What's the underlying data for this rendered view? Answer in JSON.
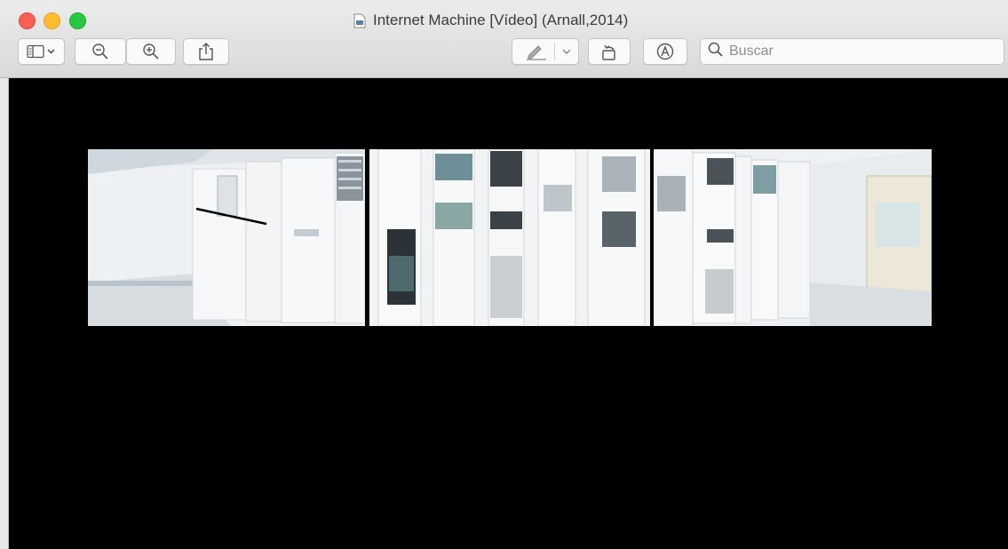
{
  "window": {
    "title": "Internet Machine [Vídeo] (Arnall,2014)"
  },
  "toolbar": {
    "buttons": [
      {
        "name": "sidebar-toggle-button",
        "icon": "sidebar-icon"
      },
      {
        "name": "zoom-out-button",
        "icon": "zoom-out-icon"
      },
      {
        "name": "zoom-in-button",
        "icon": "zoom-in-icon"
      },
      {
        "name": "share-button",
        "icon": "share-icon"
      },
      {
        "name": "markup-button",
        "icon": "pen-icon"
      },
      {
        "name": "rotate-button",
        "icon": "rotate-icon"
      },
      {
        "name": "annotate-button",
        "icon": "markup-circle-icon"
      }
    ],
    "search": {
      "placeholder": "Buscar"
    }
  },
  "viewer": {
    "background": "#000000",
    "image_panels": [
      "server-room-left",
      "server-racks-center",
      "server-room-right"
    ]
  }
}
